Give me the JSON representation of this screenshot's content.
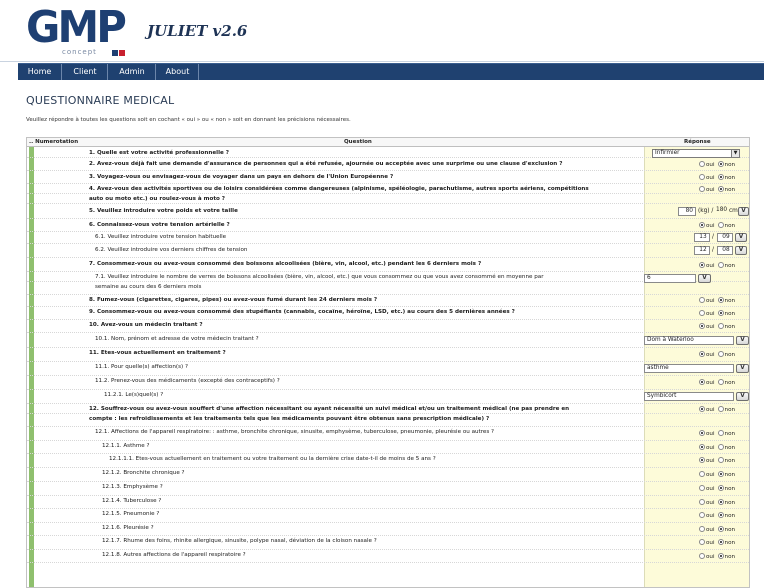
{
  "header": {
    "logo_text": "GMP",
    "logo_sub": "concept",
    "app_title": "JULIET v2.6"
  },
  "nav": {
    "items": [
      "Home",
      "Client",
      "Admin",
      "About"
    ]
  },
  "page": {
    "title": "QUESTIONNAIRE MEDICAL",
    "instructions": "Veuillez répondre à toutes les questions soit en cochant « oui » ou « non » soit en donnant les précisions nécessaires."
  },
  "table": {
    "col_num": ".. Numerotation",
    "col_question": "Question",
    "col_response": "Réponse",
    "yes_label": "oui",
    "no_label": "non",
    "validate_label": "V",
    "rows": [
      {
        "id": "r1",
        "text": "1. Quelle est votre activité professionnelle ?",
        "bold": true,
        "type": "select",
        "value": "Infirmier"
      },
      {
        "id": "r2",
        "text": "2. Avez-vous déjà fait une demande d'assurance de personnes qui a été refusée, ajournée ou acceptée avec une surprime ou une clause d'exclusion ?",
        "bold": true,
        "type": "radio",
        "answer": "non"
      },
      {
        "id": "r3",
        "text": "3. Voyagez-vous ou envisagez-vous de voyager dans un pays en dehors de l'Union Européenne ?",
        "bold": true,
        "type": "radio",
        "answer": "non"
      },
      {
        "id": "r4a",
        "text": "4. Avez-vous des activités sportives ou de loisirs considérées comme dangereuses (alpinisme, spéléologie, parachutisme, autres sports aériens, compétitions",
        "bold": true,
        "type": "radio",
        "answer": "non"
      },
      {
        "id": "r4b",
        "text": "auto ou moto etc.) ou roulez-vous à moto ?",
        "bold": true,
        "type": "none"
      },
      {
        "id": "r5",
        "text": "5. Veuillez introduire votre poids et votre taille",
        "bold": true,
        "type": "weight",
        "weight": "80",
        "weight_unit": "(kg) /",
        "height": "180",
        "height_unit": "cm"
      },
      {
        "id": "r6",
        "text": "6. Connaissez-vous votre tension artérielle ?",
        "bold": true,
        "type": "radio",
        "answer": "oui"
      },
      {
        "id": "r61",
        "text": "6.1. Veuillez introduire votre tension habituelle",
        "bold": false,
        "type": "tension",
        "a": "13",
        "b": "09"
      },
      {
        "id": "r62",
        "text": "6.2. Veuillez introduire vos derniers chiffres de tension",
        "bold": false,
        "type": "tension",
        "a": "12",
        "b": "08"
      },
      {
        "id": "r7",
        "text": "7. Consommez-vous ou avez-vous consommé des boissons alcoolisées (bière, vin, alcool, etc.) pendant les 6 derniers mois ?",
        "bold": true,
        "type": "radio",
        "answer": "oui"
      },
      {
        "id": "r71a",
        "text": "7.1. Veuillez introduire le nombre de verres de boissons alcoolisées (bière, vin, alcool, etc.) que vous consommez ou que vous avez consommé en moyenne par",
        "bold": false,
        "type": "text",
        "value": "6"
      },
      {
        "id": "r71b",
        "text": "semaine au cours des 6 derniers mois",
        "bold": false,
        "type": "none"
      },
      {
        "id": "r8",
        "text": "8. Fumez-vous (cigarettes, cigares, pipes) ou avez-vous fumé durant les 24 derniers mois ?",
        "bold": true,
        "type": "radio",
        "answer": "non"
      },
      {
        "id": "r9",
        "text": "9. Consommez-vous ou avez-vous consommé des stupéfiants (cannabis, cocaïne, héroïne, LSD, etc.) au cours des 5 dernières années ?",
        "bold": true,
        "type": "radio",
        "answer": "non"
      },
      {
        "id": "r10",
        "text": "10. Avez-vous un médecin traitant ?",
        "bold": true,
        "type": "radio",
        "answer": "oui"
      },
      {
        "id": "r101",
        "text": "10.1. Nom, prénom et adresse de votre médecin traitant ?",
        "bold": false,
        "type": "text",
        "value": "Dom à Waterloo"
      },
      {
        "id": "r11",
        "text": "11. Etes-vous actuellement en traitement ?",
        "bold": true,
        "type": "radio",
        "answer": "oui"
      },
      {
        "id": "r111",
        "text": "11.1. Pour quelle(s) affection(s) ?",
        "bold": false,
        "type": "text",
        "value": "asthme"
      },
      {
        "id": "r112",
        "text": "11.2. Prenez-vous des médicaments (excepté des contraceptifs) ?",
        "bold": false,
        "type": "radio",
        "answer": "oui"
      },
      {
        "id": "r1121",
        "text": "11.2.1. Le(s)quel(s) ?",
        "bold": false,
        "type": "text",
        "value": "Symbicort"
      },
      {
        "id": "r12a",
        "text": "12. Souffrez-vous ou avez-vous souffert d'une affection nécessitant ou ayant nécessité un suivi médical et/ou un traitement médical (ne pas prendre en",
        "bold": true,
        "type": "radio",
        "answer": "oui"
      },
      {
        "id": "r12b",
        "text": "compte : les refroidissements et les traitements tels que les médicaments pouvant être obtenus sans prescription médicale) ?",
        "bold": true,
        "type": "none"
      },
      {
        "id": "r121",
        "text": "12.1. Affections de l'appareil respiratoire: : asthme, bronchite chronique, sinusite, emphysème, tuberculose, pneumonie, pleurésie ou autres ?",
        "bold": false,
        "type": "radio",
        "answer": "oui"
      },
      {
        "id": "r1211",
        "text": "12.1.1. Asthme ?",
        "bold": false,
        "type": "radio",
        "answer": "oui"
      },
      {
        "id": "r12111",
        "text": "12.1.1.1. Etes-vous actuellement en traitement ou votre traitement ou la dernière crise date-t-il de moins de 5 ans ?",
        "bold": false,
        "type": "radio",
        "answer": "oui"
      },
      {
        "id": "r1212",
        "text": "12.1.2. Bronchite chronique ?",
        "bold": false,
        "type": "radio",
        "answer": "non"
      },
      {
        "id": "r1213",
        "text": "12.1.3. Emphysème ?",
        "bold": false,
        "type": "radio",
        "answer": "non"
      },
      {
        "id": "r1214",
        "text": "12.1.4. Tuberculose ?",
        "bold": false,
        "type": "radio",
        "answer": "non"
      },
      {
        "id": "r1215",
        "text": "12.1.5. Pneumonie ?",
        "bold": false,
        "type": "radio",
        "answer": "non"
      },
      {
        "id": "r1216",
        "text": "12.1.6. Pleurésie ?",
        "bold": false,
        "type": "radio",
        "answer": "non"
      },
      {
        "id": "r1217",
        "text": "12.1.7. Rhume des foins, rhinite allergique, sinusite, polype nasal, déviation de la cloison nasale ?",
        "bold": false,
        "type": "radio",
        "answer": "non"
      },
      {
        "id": "r1218",
        "text": "12.1.8. Autres affections de l'appareil respiratoire ?",
        "bold": false,
        "type": "radio",
        "answer": "non"
      }
    ]
  },
  "colors": {
    "brand": "#1e3f72",
    "navbar": "#1f4170",
    "response_bg": "#fdfbd9",
    "indicator_green": "#8fc06e"
  }
}
